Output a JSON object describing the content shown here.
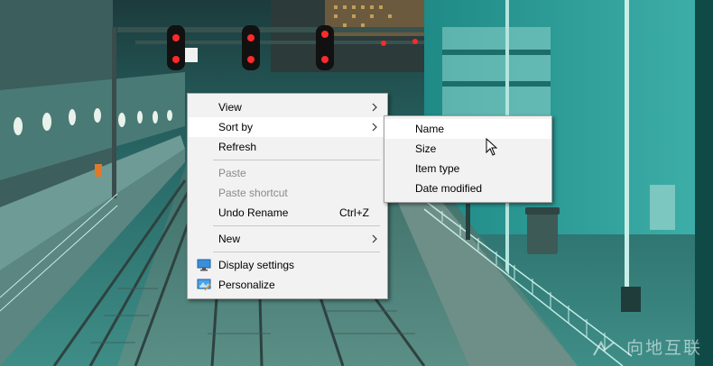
{
  "context_menu": {
    "items": [
      {
        "label": "View",
        "has_submenu": true
      },
      {
        "label": "Sort by",
        "has_submenu": true,
        "highlighted": true
      },
      {
        "label": "Refresh"
      },
      {
        "label": "Paste",
        "disabled": true
      },
      {
        "label": "Paste shortcut",
        "disabled": true
      },
      {
        "label": "Undo Rename",
        "shortcut": "Ctrl+Z"
      },
      {
        "label": "New",
        "has_submenu": true
      },
      {
        "label": "Display settings",
        "icon": "display-settings-icon"
      },
      {
        "label": "Personalize",
        "icon": "personalize-icon"
      }
    ]
  },
  "sort_by_submenu": {
    "items": [
      {
        "label": "Name",
        "highlighted": true
      },
      {
        "label": "Size"
      },
      {
        "label": "Item type"
      },
      {
        "label": "Date modified"
      }
    ]
  },
  "watermark": {
    "text": "向地互联"
  },
  "colors": {
    "menu_background": "#f2f2f2",
    "menu_highlight": "#ffffff",
    "disabled_text": "#8a8a8a",
    "wallpaper_teal": "#2d8f8c"
  }
}
